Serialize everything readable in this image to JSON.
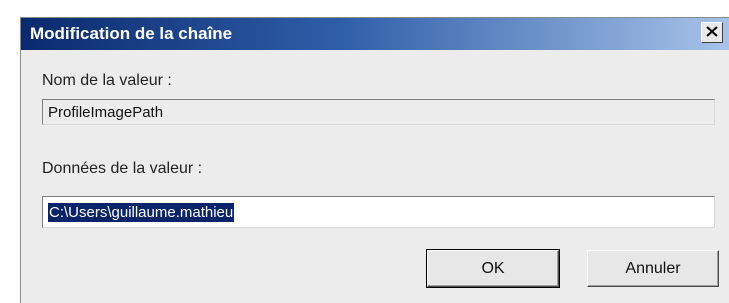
{
  "dialog": {
    "title": "Modification de la chaîne",
    "close_icon": "close-icon",
    "value_name_label": "Nom de la valeur :",
    "value_name": "ProfileImagePath",
    "value_data_label": "Données de la valeur :",
    "value_data": "C:\\Users\\guillaume.mathieu",
    "ok_label": "OK",
    "cancel_label": "Annuler"
  }
}
